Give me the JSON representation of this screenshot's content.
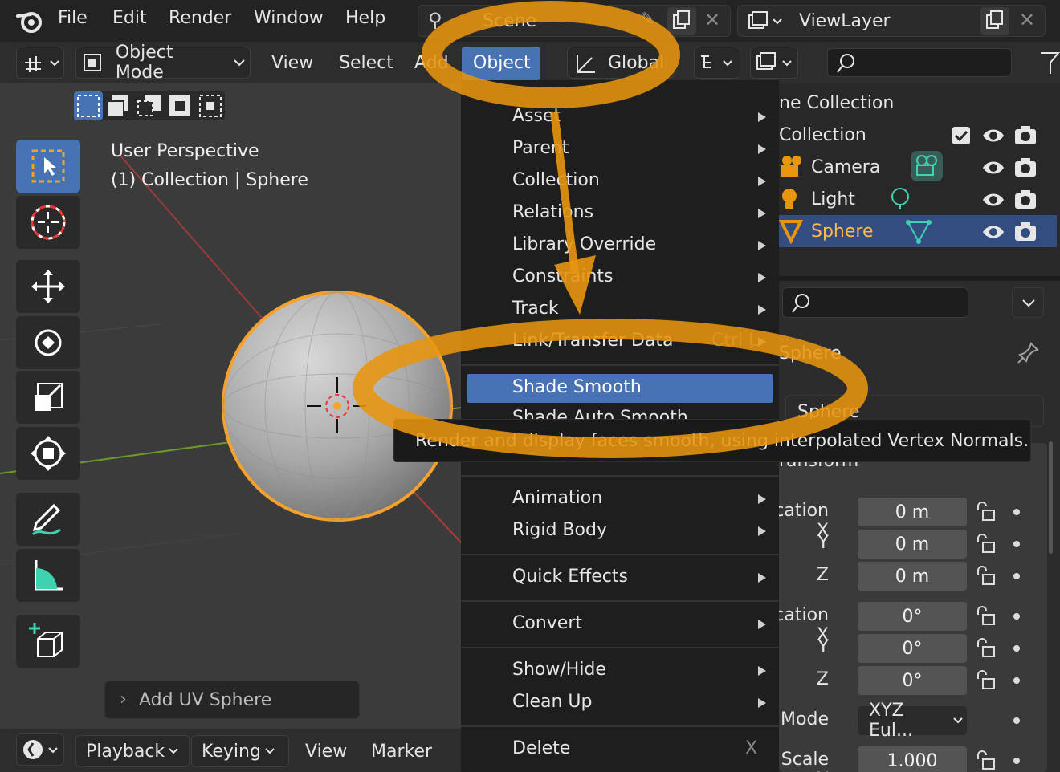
{
  "topbar": {
    "menus": [
      "File",
      "Edit",
      "Render",
      "Window",
      "Help"
    ],
    "scene": "Scene",
    "viewlayer": "ViewLayer"
  },
  "viewport_header": {
    "mode": "Object Mode",
    "menus": [
      "View",
      "Select",
      "Add",
      "Object"
    ],
    "orientation": "Global"
  },
  "viewport": {
    "perspective": "User Perspective",
    "context": "(1) Collection | Sphere",
    "last_op": "Add UV Sphere"
  },
  "object_menu": {
    "items": [
      {
        "label": "Asset",
        "submenu": true
      },
      {
        "label": "Parent",
        "submenu": true
      },
      {
        "label": "Collection",
        "submenu": true
      },
      {
        "label": "Relations",
        "submenu": true
      },
      {
        "label": "Library Override",
        "submenu": true
      },
      {
        "label": "Constraints",
        "submenu": true
      },
      {
        "label": "Track",
        "submenu": true
      },
      {
        "label": "Link/Transfer Data",
        "shortcut": "Ctrl L",
        "submenu": true
      },
      {
        "label": "Shade Smooth",
        "highlighted": true
      },
      {
        "label": "Shade Auto Smooth"
      },
      {
        "label": "Animation",
        "submenu": true
      },
      {
        "label": "Rigid Body",
        "submenu": true
      },
      {
        "label": "Quick Effects",
        "submenu": true
      },
      {
        "label": "Convert",
        "submenu": true
      },
      {
        "label": "Show/Hide",
        "submenu": true
      },
      {
        "label": "Clean Up",
        "submenu": true
      },
      {
        "label": "Delete",
        "shortcut": "X"
      }
    ]
  },
  "tooltip": "Render and display faces smooth, using interpolated Vertex Normals.",
  "outliner": {
    "scene_collection": "ne Collection",
    "collection": "Collection",
    "objects": [
      "Camera",
      "Light",
      "Sphere"
    ]
  },
  "properties": {
    "object_name": "Sphere",
    "object_name_field": "Sphere",
    "panel": "ransform",
    "location_label": "cation X",
    "rotation_label": "cation X",
    "y_label": "Y",
    "z_label": "Z",
    "location": [
      "0 m",
      "0 m",
      "0 m"
    ],
    "rotation": [
      "0°",
      "0°",
      "0°"
    ],
    "mode_label": "Mode",
    "mode": "XYZ Eul...",
    "scale_label": "Scale X",
    "scale_x": "1.000"
  },
  "timeline": {
    "menus": [
      "Playback",
      "Keying",
      "View",
      "Marker"
    ]
  },
  "colors": {
    "highlight": "#4772b3",
    "annotation": "#e8950f",
    "selected_object": "#ff9e2c",
    "object_data_icon": "#3fd1b0"
  }
}
